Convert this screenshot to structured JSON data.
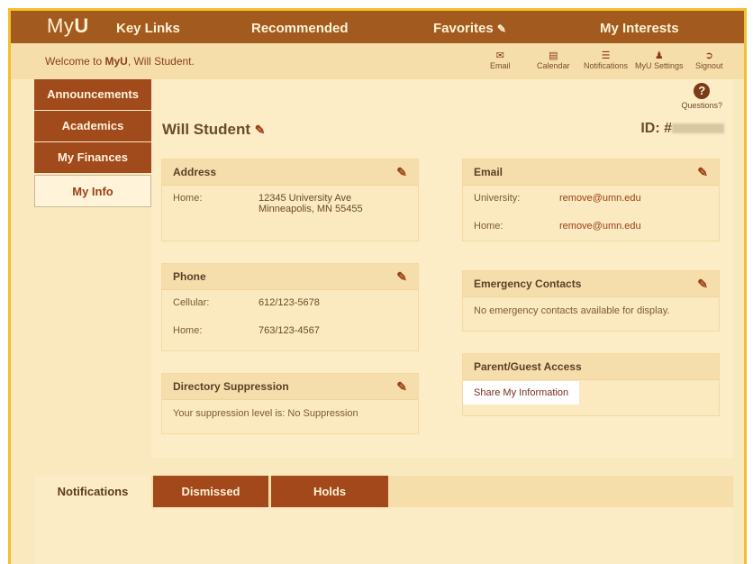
{
  "topnav": {
    "logo_prefix": "My",
    "logo_bold": "U",
    "key_links": "Key Links",
    "recommended": "Recommended",
    "favorites": "Favorites",
    "my_interests": "My Interests"
  },
  "welcome": {
    "prefix": "Welcome to ",
    "brand": "MyU",
    "suffix": ", Will Student."
  },
  "utility": {
    "email": "Email",
    "calendar": "Calendar",
    "notifications": "Notifications",
    "settings": "MyU Settings",
    "signout": "Signout"
  },
  "sidebar": {
    "items": [
      {
        "label": "Announcements"
      },
      {
        "label": "Academics"
      },
      {
        "label": "My Finances"
      },
      {
        "label": "My Info"
      }
    ]
  },
  "main": {
    "questions": "Questions?",
    "name": "Will Student",
    "id_label": "ID: #"
  },
  "address": {
    "title": "Address",
    "home_label": "Home:",
    "line1": "12345 University Ave",
    "line2": "Minneapolis, MN 55455"
  },
  "phone": {
    "title": "Phone",
    "cell_label": "Cellular:",
    "cell": "612/123-5678",
    "home_label": "Home:",
    "home": "763/123-4567"
  },
  "directory": {
    "title": "Directory Suppression",
    "text": "Your suppression level is: No Suppression"
  },
  "email": {
    "title": "Email",
    "univ_label": "University:",
    "univ": "remove@umn.edu",
    "home_label": "Home:",
    "home": "remove@umn.edu"
  },
  "emergency": {
    "title": "Emergency Contacts",
    "text": "No emergency contacts available for display."
  },
  "parent": {
    "title": "Parent/Guest Access",
    "share": "Share My Information"
  },
  "tabs": [
    {
      "label": "Notifications"
    },
    {
      "label": "Dismissed"
    },
    {
      "label": "Holds"
    }
  ]
}
